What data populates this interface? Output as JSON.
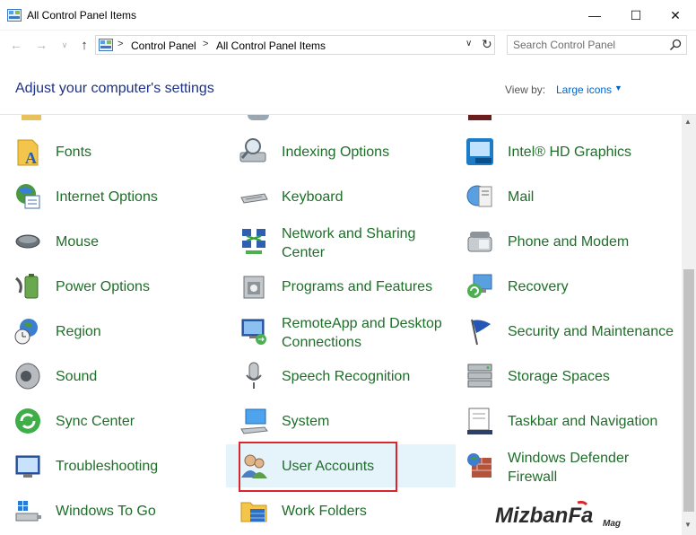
{
  "window": {
    "title": "All Control Panel Items",
    "min_glyph": "—",
    "max_glyph": "☐",
    "close_glyph": "✕"
  },
  "nav": {
    "breadcrumb": [
      "Control Panel",
      "All Control Panel Items"
    ],
    "separator": ">",
    "search_placeholder": "Search Control Panel"
  },
  "header": {
    "heading": "Adjust your computer's settings",
    "view_by_label": "View by:",
    "view_by_value": "Large icons"
  },
  "items": [
    {
      "label": "Fonts",
      "icon": "fonts-icon"
    },
    {
      "label": "Indexing Options",
      "icon": "indexing-icon"
    },
    {
      "label": "Intel® HD Graphics",
      "icon": "intel-graphics-icon"
    },
    {
      "label": "Internet Options",
      "icon": "internet-options-icon"
    },
    {
      "label": "Keyboard",
      "icon": "keyboard-icon"
    },
    {
      "label": "Mail",
      "icon": "mail-icon"
    },
    {
      "label": "Mouse",
      "icon": "mouse-icon"
    },
    {
      "label": "Network and Sharing Center",
      "icon": "network-icon"
    },
    {
      "label": "Phone and Modem",
      "icon": "phone-icon"
    },
    {
      "label": "Power Options",
      "icon": "power-icon"
    },
    {
      "label": "Programs and Features",
      "icon": "programs-icon"
    },
    {
      "label": "Recovery",
      "icon": "recovery-icon"
    },
    {
      "label": "Region",
      "icon": "region-icon"
    },
    {
      "label": "RemoteApp and Desktop Connections",
      "icon": "remoteapp-icon"
    },
    {
      "label": "Security and Maintenance",
      "icon": "security-flag-icon"
    },
    {
      "label": "Sound",
      "icon": "sound-icon"
    },
    {
      "label": "Speech Recognition",
      "icon": "microphone-icon"
    },
    {
      "label": "Storage Spaces",
      "icon": "storage-icon"
    },
    {
      "label": "Sync Center",
      "icon": "sync-icon"
    },
    {
      "label": "System",
      "icon": "system-icon"
    },
    {
      "label": "Taskbar and Navigation",
      "icon": "taskbar-icon"
    },
    {
      "label": "Troubleshooting",
      "icon": "troubleshooting-icon"
    },
    {
      "label": "User Accounts",
      "icon": "user-accounts-icon"
    },
    {
      "label": "Windows Defender Firewall",
      "icon": "firewall-icon"
    },
    {
      "label": "Windows To Go",
      "icon": "windows-to-go-icon"
    },
    {
      "label": "Work Folders",
      "icon": "work-folders-icon"
    }
  ],
  "colors": {
    "item_text": "#1e6e29",
    "heading_text": "#1e3287",
    "link": "#0066cc",
    "selection_bg": "#e5f3fb",
    "annotation_box": "#d9262a"
  }
}
